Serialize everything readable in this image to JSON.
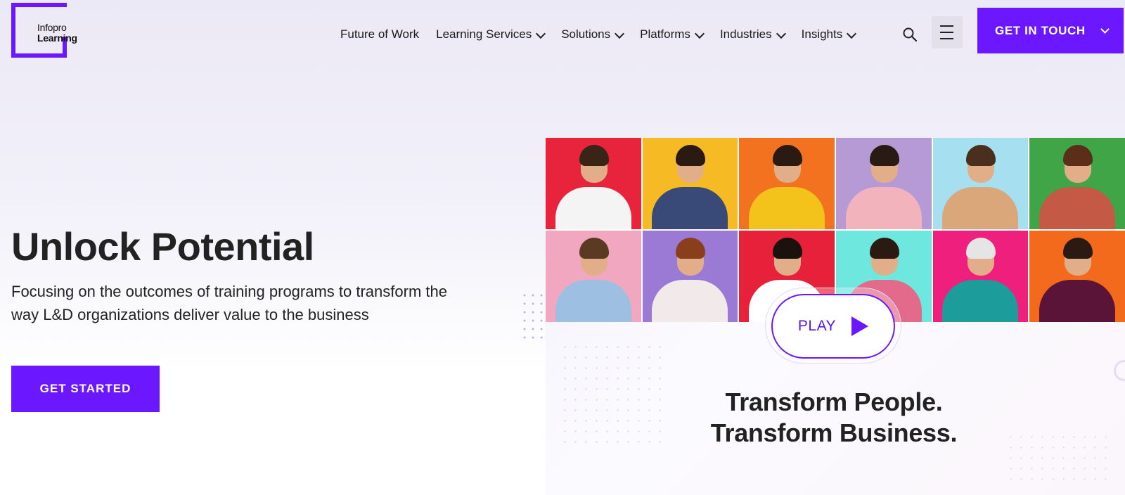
{
  "logo": {
    "line1": "Infopro",
    "line2": "Learning"
  },
  "nav": {
    "items": [
      {
        "label": "Future of Work",
        "dropdown": false
      },
      {
        "label": "Learning Services",
        "dropdown": true
      },
      {
        "label": "Solutions",
        "dropdown": true
      },
      {
        "label": "Platforms",
        "dropdown": true
      },
      {
        "label": "Industries",
        "dropdown": true
      },
      {
        "label": "Insights",
        "dropdown": true
      }
    ],
    "search_icon": "search-icon",
    "menu_icon": "hamburger-menu-icon",
    "cta_label": "GET IN TOUCH"
  },
  "hero": {
    "title": "Unlock Potential",
    "subtitle": "Focusing on the outcomes of training programs to transform the way L&D organizations deliver value to the business",
    "cta_label": "GET STARTED"
  },
  "media": {
    "play_label": "PLAY",
    "tagline_1": "Transform People.",
    "tagline_2": "Transform Business.",
    "tiles": [
      {
        "bg": "#e8243c",
        "shirt": "#f4f4f4",
        "hair": "#3a2418"
      },
      {
        "bg": "#f6bb24",
        "shirt": "#3a4a78",
        "hair": "#2a1a12"
      },
      {
        "bg": "#f3721f",
        "shirt": "#f3c21b",
        "hair": "#2b1a12"
      },
      {
        "bg": "#b69ad6",
        "shirt": "#f3b3bd",
        "hair": "#2a1a14"
      },
      {
        "bg": "#a6dff0",
        "shirt": "#d9a77a",
        "hair": "#4a2f1f"
      },
      {
        "bg": "#3fa546",
        "shirt": "#c45a45",
        "hair": "#5a2e18"
      },
      {
        "bg": "#f2a7c1",
        "shirt": "#9cbfe2",
        "hair": "#5a3a22"
      },
      {
        "bg": "#9a7ad4",
        "shirt": "#f2eaea",
        "hair": "#8a3f1c"
      },
      {
        "bg": "#e8213a",
        "shirt": "#ffffff",
        "hair": "#1a120c"
      },
      {
        "bg": "#6ee7df",
        "shirt": "#e36a8a",
        "hair": "#2a1a12"
      },
      {
        "bg": "#ee1f7d",
        "shirt": "#1d9c9c",
        "hair": "#e5e5e5"
      },
      {
        "bg": "#f36a1d",
        "shirt": "#5a1438",
        "hair": "#2a1a12"
      }
    ]
  }
}
